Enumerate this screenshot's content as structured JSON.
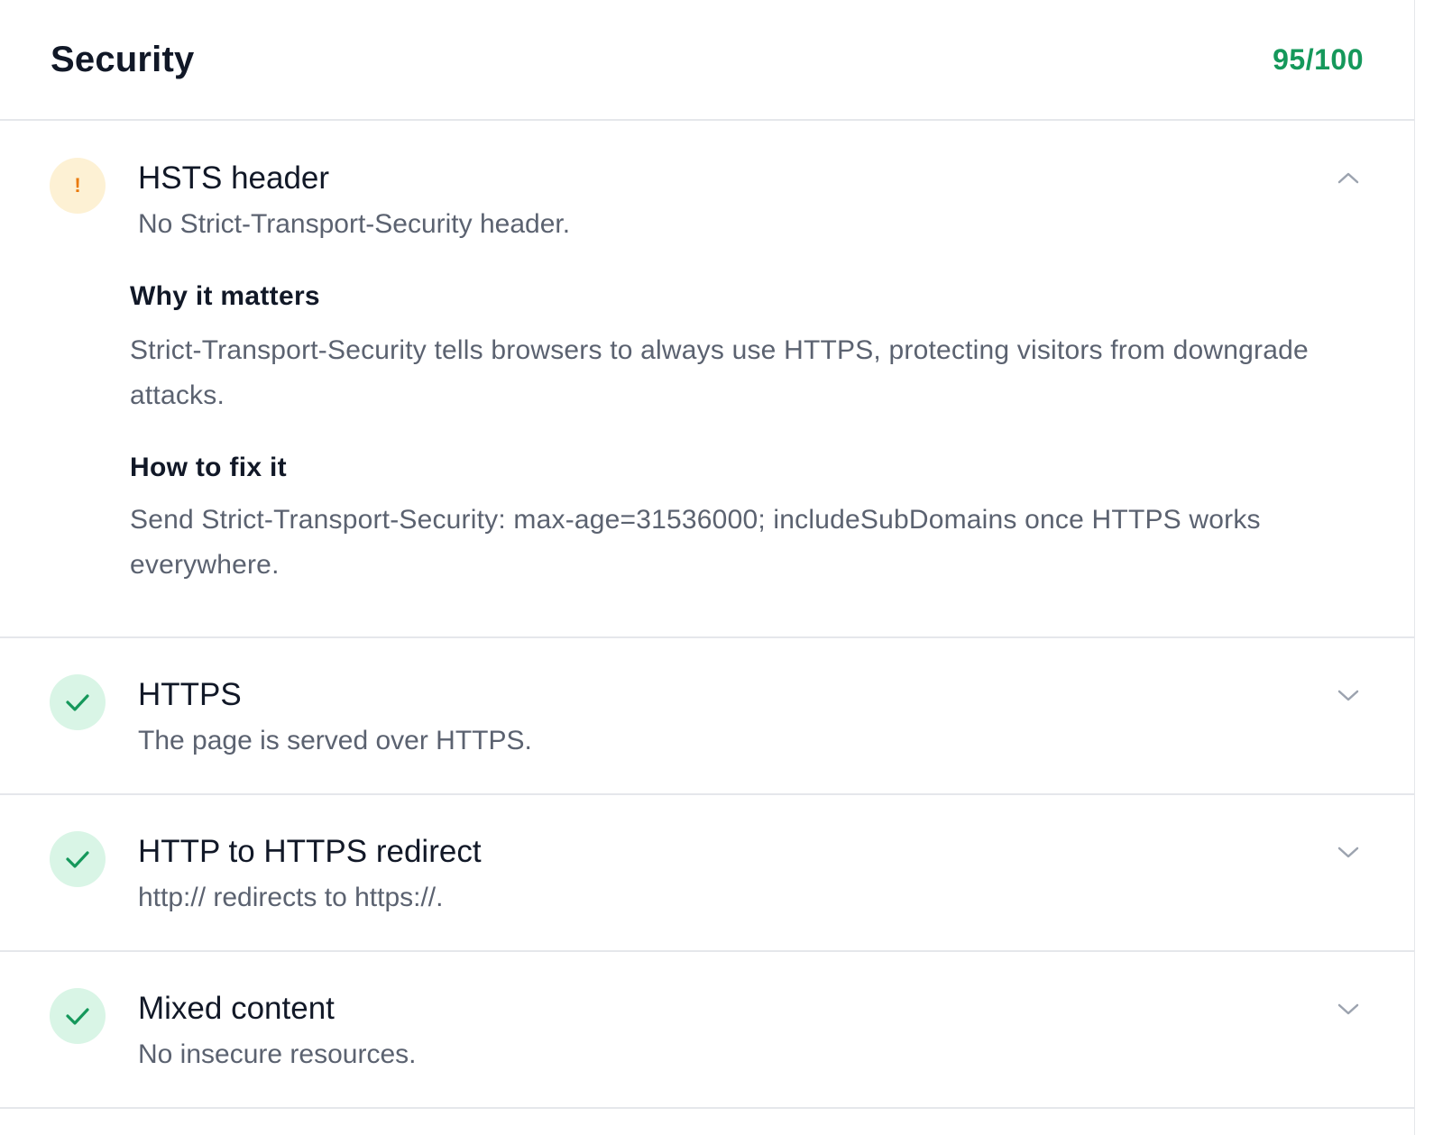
{
  "panel": {
    "title": "Security",
    "score": "95/100",
    "score_color": "#15985b"
  },
  "checks": [
    {
      "status": "warning",
      "status_icon": "exclamation-icon",
      "status_mark": "!",
      "title": "HSTS header",
      "summary": "No Strict-Transport-Security header.",
      "expanded": true,
      "toggle_icon": "chevron-up-icon",
      "details": {
        "why_heading": "Why it matters",
        "why_body": "Strict-Transport-Security tells browsers to always use HTTPS, protecting visitors from downgrade attacks.",
        "fix_heading": "How to fix it",
        "fix_body": "Send Strict-Transport-Security: max-age=31536000; includeSubDomains once HTTPS works everywhere."
      }
    },
    {
      "status": "pass",
      "status_icon": "check-icon",
      "title": "HTTPS",
      "summary": "The page is served over HTTPS.",
      "expanded": false,
      "toggle_icon": "chevron-down-icon"
    },
    {
      "status": "pass",
      "status_icon": "check-icon",
      "title": "HTTP to HTTPS redirect",
      "summary": "http:// redirects to https://.",
      "expanded": false,
      "toggle_icon": "chevron-down-icon"
    },
    {
      "status": "pass",
      "status_icon": "check-icon",
      "title": "Mixed content",
      "summary": "No insecure resources.",
      "expanded": false,
      "toggle_icon": "chevron-down-icon"
    }
  ],
  "colors": {
    "warning_bg": "#fdf1d4",
    "warning_fg": "#ea7a0c",
    "pass_bg": "#d9f5e6",
    "pass_fg": "#15985b",
    "divider": "#e5e7eb",
    "muted_text": "#5b6270"
  }
}
